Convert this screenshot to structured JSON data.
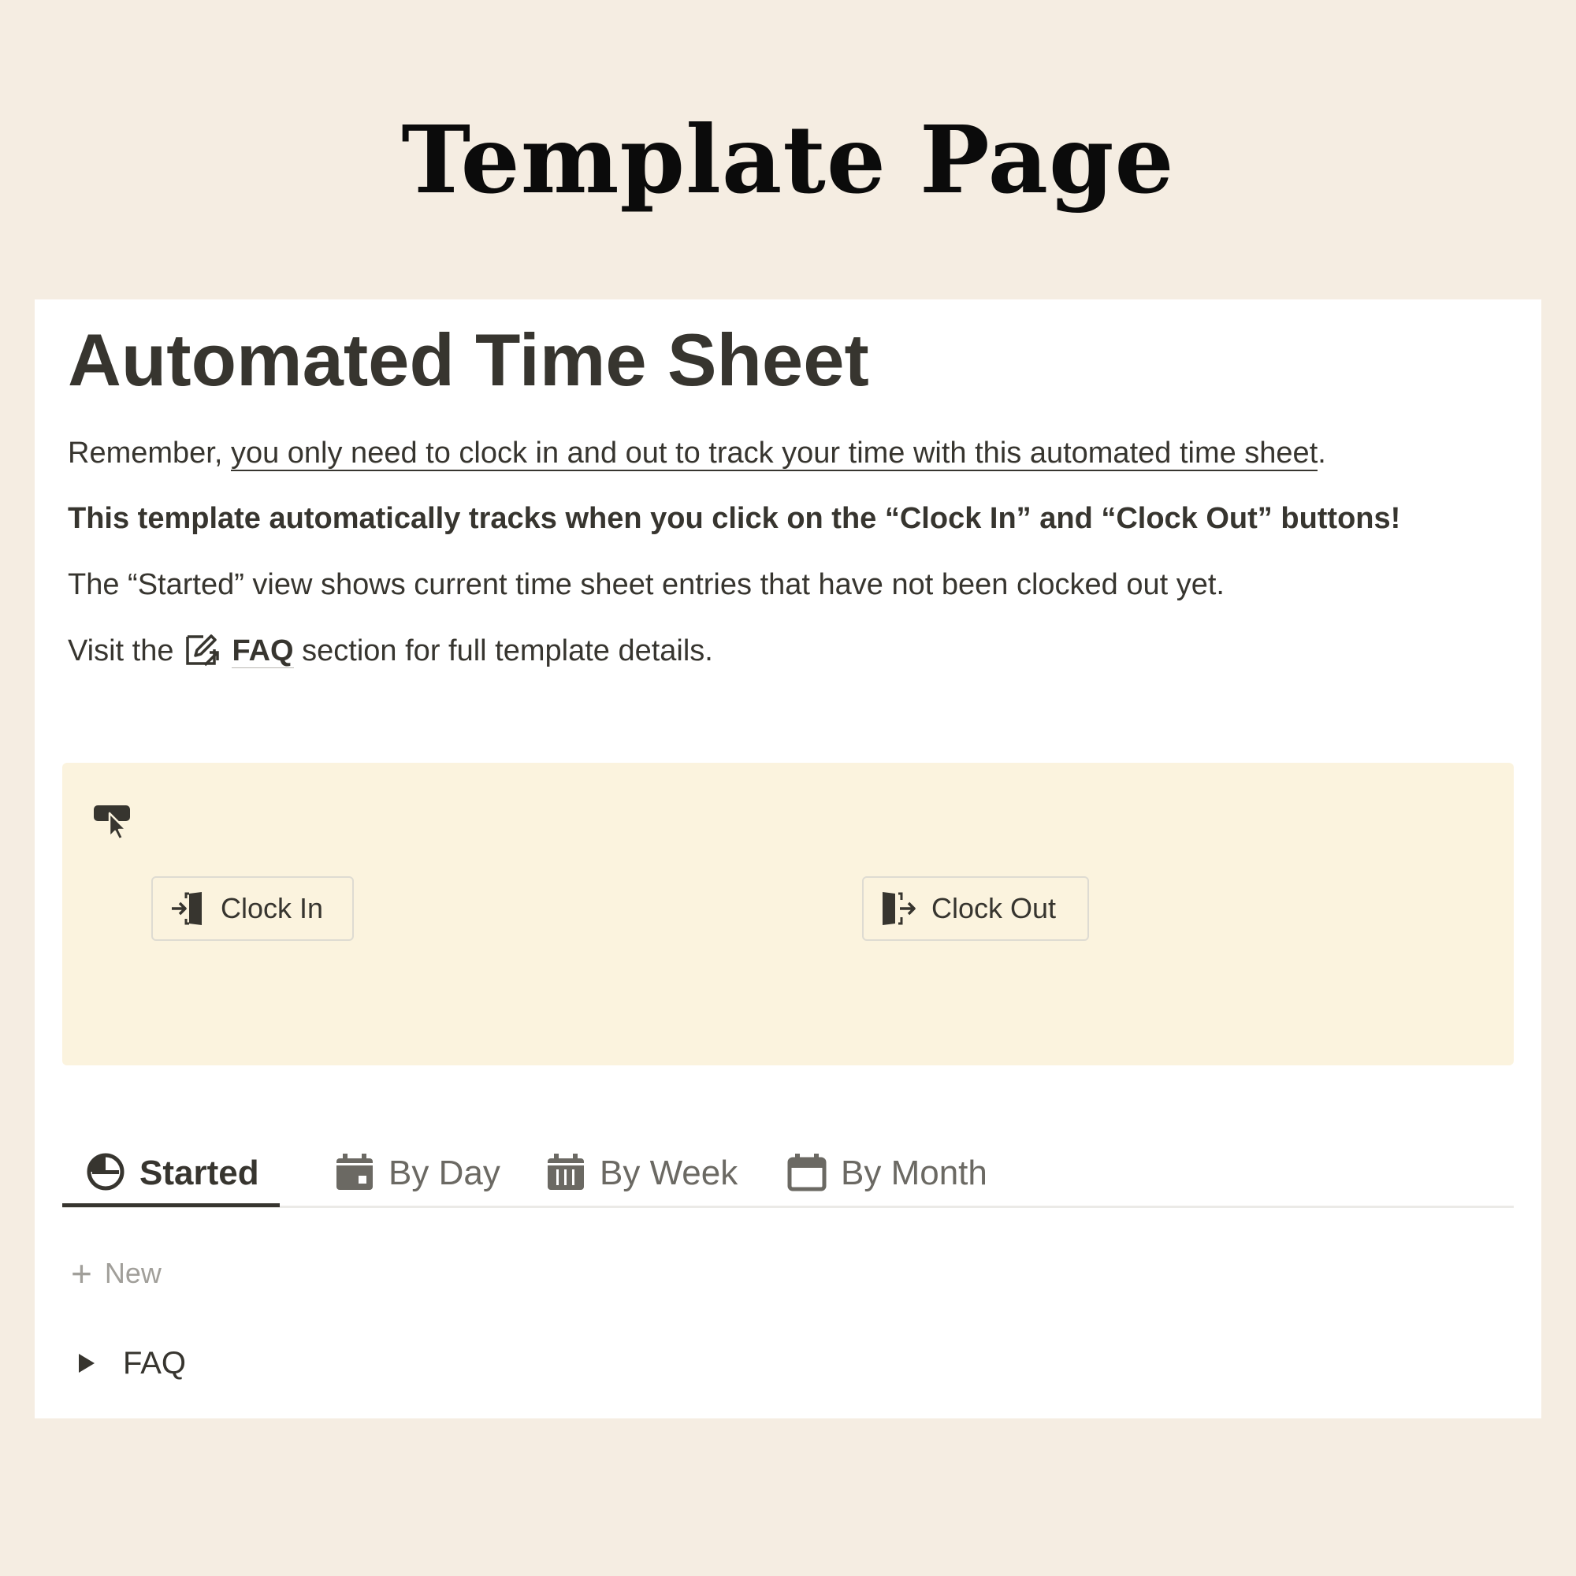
{
  "banner": {
    "title": "Template Page"
  },
  "page": {
    "title": "Automated Time Sheet",
    "p1_prefix": "Remember, ",
    "p1_underlined": "you only need to clock in and out to track your time with this automated time sheet",
    "p1_suffix": ".",
    "p2": "This template automatically tracks when you click on the “Clock In” and “Clock Out” buttons!",
    "p3": "The “Started” view shows current time sheet entries that have not been clocked out yet.",
    "p4_prefix": "Visit the",
    "p4_link": "FAQ",
    "p4_suffix": " section for full template details."
  },
  "callout": {
    "icon": "pointer-hand-icon",
    "buttons": [
      {
        "label": "Clock In",
        "icon": "login-icon"
      },
      {
        "label": "Clock Out",
        "icon": "logout-icon"
      }
    ]
  },
  "tabs": [
    {
      "label": "Started",
      "icon": "clock-icon",
      "active": true
    },
    {
      "label": "By Day",
      "icon": "calendar-day-icon",
      "active": false
    },
    {
      "label": "By Week",
      "icon": "calendar-week-icon",
      "active": false
    },
    {
      "label": "By Month",
      "icon": "calendar-month-icon",
      "active": false
    }
  ],
  "new_row": {
    "label": "New"
  },
  "toggle": {
    "label": "FAQ"
  },
  "colors": {
    "background": "#f5ede2",
    "callout": "#fbf3de",
    "text": "#37352f",
    "muted": "#a19f9a"
  }
}
